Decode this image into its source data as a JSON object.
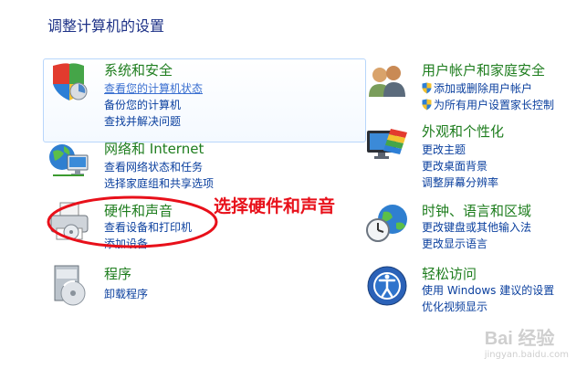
{
  "title": "调整计算机的设置",
  "categories": {
    "system_security": {
      "heading": "系统和安全",
      "icon": "shield-icon",
      "links": [
        "查看您的计算机状态",
        "备份您的计算机",
        "查找并解决问题"
      ]
    },
    "network": {
      "heading": "网络和 Internet",
      "icon": "network-globe-icon",
      "links": [
        "查看网络状态和任务",
        "选择家庭组和共享选项"
      ]
    },
    "hardware_sound": {
      "heading": "硬件和声音",
      "icon": "printer-icon",
      "links": [
        "查看设备和打印机",
        "添加设备"
      ]
    },
    "programs": {
      "heading": "程序",
      "icon": "programs-disc-icon",
      "links": [
        "卸载程序"
      ]
    },
    "user_accounts": {
      "heading": "用户帐户和家庭安全",
      "icon": "users-icon",
      "links": [
        "添加或删除用户帐户",
        "为所有用户设置家长控制"
      ]
    },
    "appearance": {
      "heading": "外观和个性化",
      "icon": "monitor-palette-icon",
      "links": [
        "更改主题",
        "更改桌面背景",
        "调整屏幕分辨率"
      ]
    },
    "clock_region": {
      "heading": "时钟、语言和区域",
      "icon": "clock-globe-icon",
      "links": [
        "更改键盘或其他输入法",
        "更改显示语言"
      ]
    },
    "ease_access": {
      "heading": "轻松访问",
      "icon": "ease-of-access-icon",
      "links": [
        "使用 Windows 建议的设置",
        "优化视频显示"
      ]
    }
  },
  "annotation": "选择硬件和声音",
  "watermark": {
    "main": "Bai 经验",
    "sub": "jingyan.baidu.com"
  },
  "colors": {
    "heading": "#1e7d1e",
    "link": "#0a3f9e",
    "annotation": "#e8101a",
    "title": "#1e3287"
  }
}
